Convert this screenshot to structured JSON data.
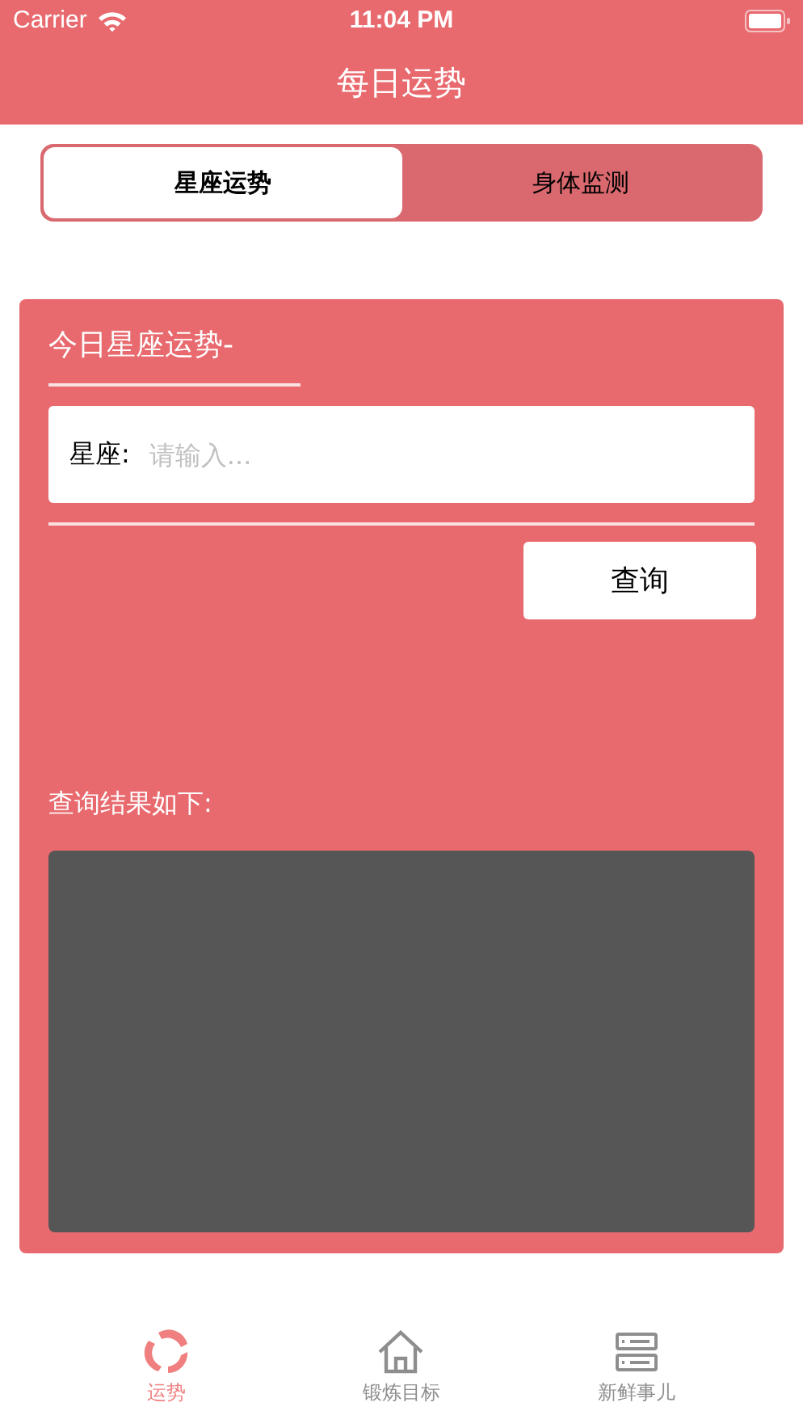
{
  "status_bar": {
    "carrier": "Carrier",
    "time": "11:04 PM"
  },
  "nav_bar": {
    "title": "每日运势"
  },
  "segments": [
    {
      "label": "星座运势",
      "selected": true
    },
    {
      "label": "身体监测",
      "selected": false
    }
  ],
  "card": {
    "title": "今日星座运势-",
    "field_label": "星座:",
    "placeholder": "请输入...",
    "button": "查询",
    "result_label": "查询结果如下:"
  },
  "tab_bar": [
    {
      "label": "运势",
      "kind": "fortune",
      "selected": true
    },
    {
      "label": "锻炼目标",
      "kind": "home",
      "selected": false
    },
    {
      "label": "新鲜事儿",
      "kind": "list",
      "selected": false
    }
  ]
}
